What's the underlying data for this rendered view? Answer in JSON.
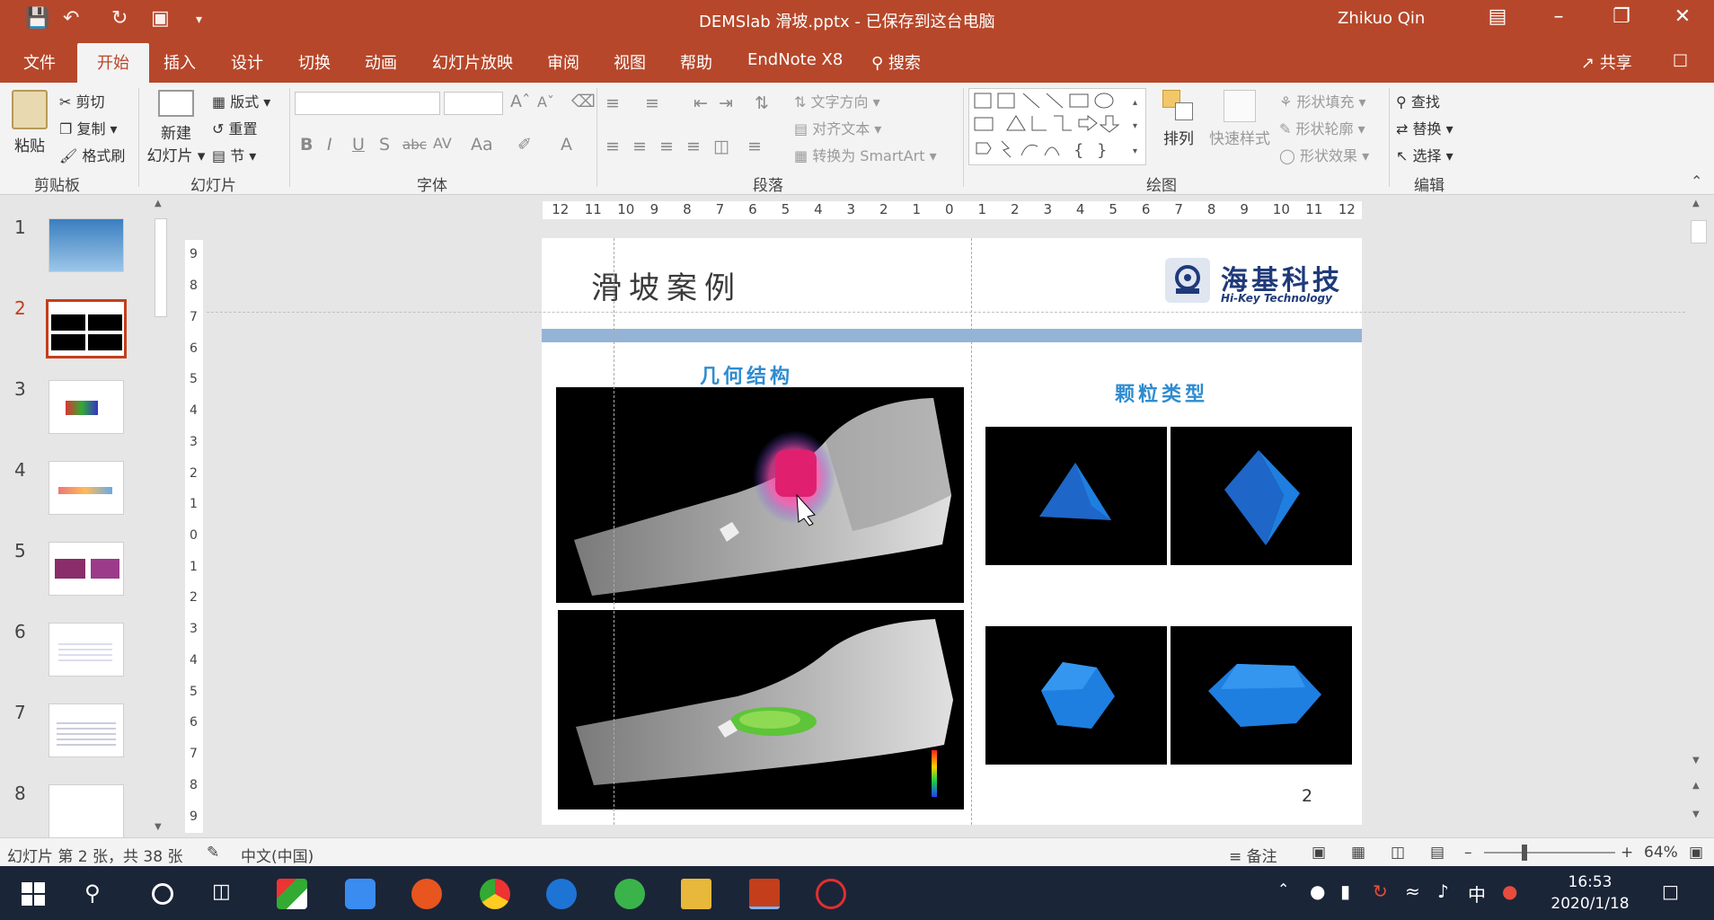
{
  "titlebar": {
    "title": "DEMSlab 滑坡.pptx - 已保存到这台电脑",
    "user": "Zhikuo Qin"
  },
  "tabs": [
    "文件",
    "开始",
    "插入",
    "设计",
    "切换",
    "动画",
    "幻灯片放映",
    "审阅",
    "视图",
    "帮助",
    "EndNote X8",
    "搜索"
  ],
  "share_label": "共享",
  "ribbon": {
    "clipboard": {
      "label": "剪贴板",
      "paste": "粘贴",
      "cut": "剪切",
      "copy": "复制",
      "format_painter": "格式刷"
    },
    "slides": {
      "label": "幻灯片",
      "new_slide_line1": "新建",
      "new_slide_line2": "幻灯片",
      "layout": "版式",
      "reset": "重置",
      "section": "节"
    },
    "font": {
      "label": "字体",
      "bold": "B",
      "italic": "I",
      "underline": "U",
      "shadow": "S",
      "strike": "abc",
      "spacing": "AV",
      "case": "Aa",
      "color": "A"
    },
    "paragraph": {
      "label": "段落",
      "text_direction": "文字方向",
      "align_text": "对齐文本",
      "smartart": "转换为 SmartArt"
    },
    "drawing": {
      "label": "绘图",
      "arrange": "排列",
      "quick_styles": "快速样式",
      "shape_fill": "形状填充",
      "shape_outline": "形状轮廓",
      "shape_effect": "形状效果"
    },
    "editing": {
      "label": "编辑",
      "find": "查找",
      "replace": "替换",
      "select": "选择"
    }
  },
  "thumbnails": [
    "1",
    "2",
    "3",
    "4",
    "5",
    "6",
    "7",
    "8"
  ],
  "selected_slide": 2,
  "ruler_h": [
    "12",
    "11",
    "10",
    "9",
    "8",
    "7",
    "6",
    "5",
    "4",
    "3",
    "2",
    "1",
    "0",
    "1",
    "2",
    "3",
    "4",
    "5",
    "6",
    "7",
    "8",
    "9",
    "10",
    "11",
    "12"
  ],
  "ruler_v": [
    "9",
    "8",
    "7",
    "6",
    "5",
    "4",
    "3",
    "2",
    "1",
    "0",
    "1",
    "2",
    "3",
    "4",
    "5",
    "6",
    "7",
    "8",
    "9"
  ],
  "slide": {
    "title": "滑坡案例",
    "logo_cn": "海基科技",
    "logo_en": "Hi-Key Technology",
    "left_heading": "几何结构",
    "right_heading": "颗粒类型",
    "page_number": "2"
  },
  "status": {
    "slide_info": "幻灯片 第 2 张，共 38 张",
    "language": "中文(中国)",
    "notes": "备注",
    "zoom": "64%"
  },
  "taskbar": {
    "time": "16:53",
    "date": "2020/1/18",
    "ime": "中"
  },
  "colors": {
    "accent": "#b7472a",
    "slide_bar": "#95b3d7",
    "heading": "#2f8cd0",
    "particle": "#1e7fe0"
  }
}
